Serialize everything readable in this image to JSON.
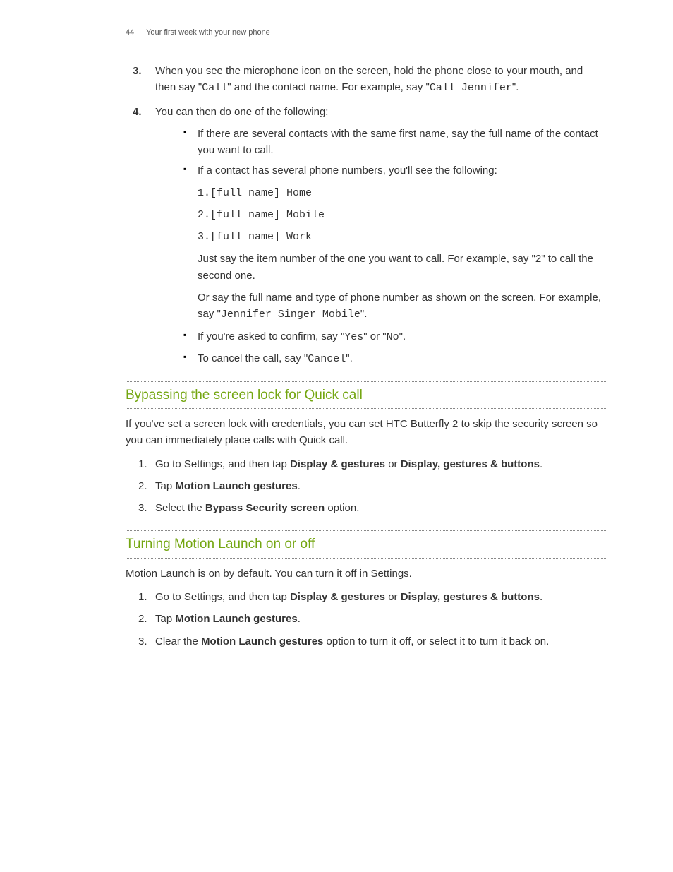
{
  "header": {
    "page_number": "44",
    "chapter": "Your first week with your new phone"
  },
  "main_list": {
    "item3": {
      "num": "3.",
      "pre": "When you see the microphone icon on the screen, hold the phone close to your mouth, and then say \"",
      "code1": "Call",
      "mid": "\" and the contact name. For example, say \"",
      "code2": "Call Jennifer",
      "post": "\"."
    },
    "item4": {
      "num": "4.",
      "text": "You can then do one of the following:",
      "bullets": {
        "b1": "If there are several contacts with the same first name, say the full name of the contact you want to call.",
        "b2": {
          "lead": "If a contact has several phone numbers, you'll see the following:",
          "lines": {
            "l1": "1.[full name] Home",
            "l2": "2.[full name] Mobile",
            "l3": "3.[full name] Work"
          },
          "p1": "Just say the item number of the one you want to call. For example, say \"2\" to call the second one.",
          "p2_pre": "Or say the full name and type of phone number as shown on the screen. For example, say \"",
          "p2_code": "Jennifer Singer Mobile",
          "p2_post": "\"."
        },
        "b3": {
          "pre": "If you're asked to confirm, say \"",
          "c1": "Yes",
          "mid": "\" or \"",
          "c2": "No",
          "post": "\"."
        },
        "b4": {
          "pre": "To cancel the call, say \"",
          "c1": "Cancel",
          "post": "\"."
        }
      }
    }
  },
  "section1": {
    "title": "Bypassing the screen lock for Quick call",
    "intro": "If you've set a screen lock with credentials, you can set HTC Butterfly 2 to skip the security screen so you can immediately place calls with Quick call.",
    "steps": {
      "s1": {
        "num": "1.",
        "pre": "Go to Settings, and then tap ",
        "b1": "Display & gestures",
        "mid": " or ",
        "b2": "Display, gestures & buttons",
        "post": "."
      },
      "s2": {
        "num": "2.",
        "pre": "Tap ",
        "b1": "Motion Launch gestures",
        "post": "."
      },
      "s3": {
        "num": "3.",
        "pre": "Select the ",
        "b1": "Bypass Security screen",
        "post": " option."
      }
    }
  },
  "section2": {
    "title": "Turning Motion Launch on or off",
    "intro": "Motion Launch is on by default. You can turn it off in Settings.",
    "steps": {
      "s1": {
        "num": "1.",
        "pre": "Go to Settings, and then tap ",
        "b1": "Display & gestures",
        "mid": " or ",
        "b2": "Display, gestures & buttons",
        "post": "."
      },
      "s2": {
        "num": "2.",
        "pre": "Tap ",
        "b1": "Motion Launch gestures",
        "post": "."
      },
      "s3": {
        "num": "3.",
        "pre": "Clear the ",
        "b1": "Motion Launch gestures",
        "post": " option to turn it off, or select it to turn it back on."
      }
    }
  }
}
